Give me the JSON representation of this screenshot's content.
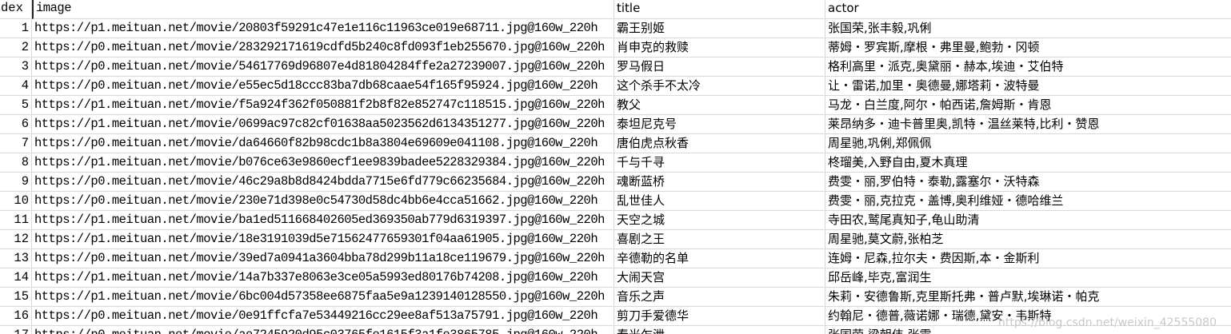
{
  "columns": {
    "index": "dex",
    "image": "image",
    "title": "title",
    "actor": "actor"
  },
  "rows": [
    {
      "index": "1",
      "image": "https://p1.meituan.net/movie/20803f59291c47e1e116c11963ce019e68711.jpg@160w_220h",
      "title": "霸王别姬",
      "actor": "张国荣,张丰毅,巩俐"
    },
    {
      "index": "2",
      "image": "https://p0.meituan.net/movie/283292171619cdfd5b240c8fd093f1eb255670.jpg@160w_220h",
      "title": "肖申克的救赎",
      "actor": "蒂姆・罗宾斯,摩根・弗里曼,鲍勃・冈顿"
    },
    {
      "index": "3",
      "image": "https://p0.meituan.net/movie/54617769d96807e4d81804284ffe2a27239007.jpg@160w_220h",
      "title": "罗马假日",
      "actor": "格利高里・派克,奥黛丽・赫本,埃迪・艾伯特"
    },
    {
      "index": "4",
      "image": "https://p0.meituan.net/movie/e55ec5d18ccc83ba7db68caae54f165f95924.jpg@160w_220h",
      "title": "这个杀手不太冷",
      "actor": "让・雷诺,加里・奥德曼,娜塔莉・波特曼"
    },
    {
      "index": "5",
      "image": "https://p1.meituan.net/movie/f5a924f362f050881f2b8f82e852747c118515.jpg@160w_220h",
      "title": "教父",
      "actor": "马龙・白兰度,阿尔・帕西诺,詹姆斯・肯恩"
    },
    {
      "index": "6",
      "image": "https://p1.meituan.net/movie/0699ac97c82cf01638aa5023562d6134351277.jpg@160w_220h",
      "title": "泰坦尼克号",
      "actor": "莱昂纳多・迪卡普里奥,凯特・温丝莱特,比利・赞恩"
    },
    {
      "index": "7",
      "image": "https://p0.meituan.net/movie/da64660f82b98cdc1b8a3804e69609e041108.jpg@160w_220h",
      "title": "唐伯虎点秋香",
      "actor": "周星驰,巩俐,郑佩佩"
    },
    {
      "index": "8",
      "image": "https://p1.meituan.net/movie/b076ce63e9860ecf1ee9839badee5228329384.jpg@160w_220h",
      "title": "千与千寻",
      "actor": "柊瑠美,入野自由,夏木真理"
    },
    {
      "index": "9",
      "image": "https://p0.meituan.net/movie/46c29a8b8d8424bdda7715e6fd779c66235684.jpg@160w_220h",
      "title": "魂断蓝桥",
      "actor": "费雯・丽,罗伯特・泰勒,露塞尔・沃特森"
    },
    {
      "index": "10",
      "image": "https://p0.meituan.net/movie/230e71d398e0c54730d58dc4bb6e4cca51662.jpg@160w_220h",
      "title": "乱世佳人",
      "actor": "费雯・丽,克拉克・盖博,奥利维娅・德哈维兰"
    },
    {
      "index": "11",
      "image": "https://p1.meituan.net/movie/ba1ed511668402605ed369350ab779d6319397.jpg@160w_220h",
      "title": "天空之城",
      "actor": "寺田农,鹫尾真知子,龟山助清"
    },
    {
      "index": "12",
      "image": "https://p1.meituan.net/movie/18e3191039d5e71562477659301f04aa61905.jpg@160w_220h",
      "title": "喜剧之王",
      "actor": "周星驰,莫文蔚,张柏芝"
    },
    {
      "index": "13",
      "image": "https://p0.meituan.net/movie/39ed7a0941a3604bba78d299b11a18ce119679.jpg@160w_220h",
      "title": "辛德勒的名单",
      "actor": "连姆・尼森,拉尔夫・费因斯,本・金斯利"
    },
    {
      "index": "14",
      "image": "https://p1.meituan.net/movie/14a7b337e8063e3ce05a5993ed80176b74208.jpg@160w_220h",
      "title": "大闹天宫",
      "actor": "邱岳峰,毕克,富润生"
    },
    {
      "index": "15",
      "image": "https://p1.meituan.net/movie/6bc004d57358ee6875faa5e9a1239140128550.jpg@160w_220h",
      "title": "音乐之声",
      "actor": "朱莉・安德鲁斯,克里斯托弗・普卢默,埃琳诺・帕克"
    },
    {
      "index": "16",
      "image": "https://p0.meituan.net/movie/0e91ffcfa7e53449216cc29ee8af513a75791.jpg@160w_220h",
      "title": "剪刀手爱德华",
      "actor": "约翰尼・德普,薇诺娜・瑞德,黛安・韦斯特"
    },
    {
      "index": "17",
      "image": "https://p0.meituan.net/movie/ae7245920d95c03765fe1615f3a1fe3865785.jpg@160w_220h",
      "title": "春光乍泄",
      "actor": "张国荣,梁朝伟,张震"
    }
  ],
  "watermark": "https://blog.csdn.net/weixin_42555080"
}
